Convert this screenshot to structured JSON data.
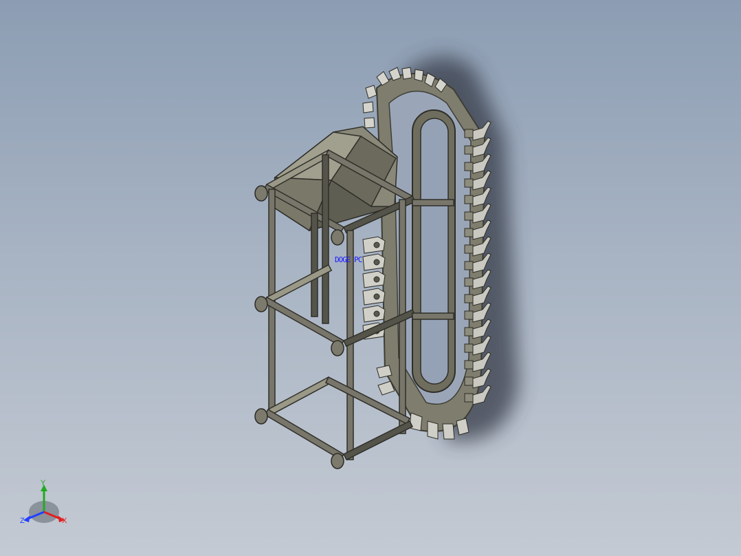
{
  "viewport": {
    "annotation": "DOGE PC",
    "triad": {
      "x": "X",
      "y": "Y",
      "z": "Z"
    }
  },
  "model": {
    "name_icon": "chain-conveyor-elevator-frame",
    "colors": {
      "frame": "#6f6d5e",
      "frame_light": "#8e8b78",
      "frame_dark": "#4a4940",
      "chain_plate": "#8a8878",
      "bucket": "#c8c8c0",
      "shadow": "#3c4250"
    }
  }
}
